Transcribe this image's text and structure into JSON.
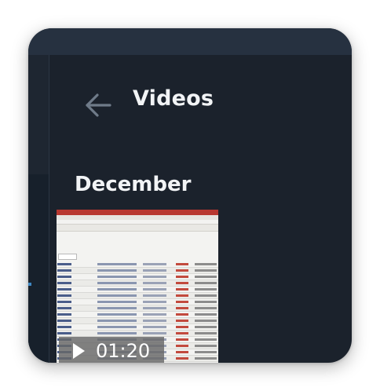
{
  "header": {
    "title": "Videos",
    "back_icon": "arrow-left-icon"
  },
  "sections": [
    {
      "heading": "December",
      "videos": [
        {
          "duration": "01:20",
          "thumbnail": "spreadsheet-screenshot",
          "play_icon": "play-icon"
        }
      ]
    }
  ],
  "colors": {
    "background": "#1b222c",
    "top_strip": "#263140",
    "text": "#f2f4f6",
    "back_arrow": "#6f7b89",
    "thumbnail_accent": "#b8372f"
  }
}
